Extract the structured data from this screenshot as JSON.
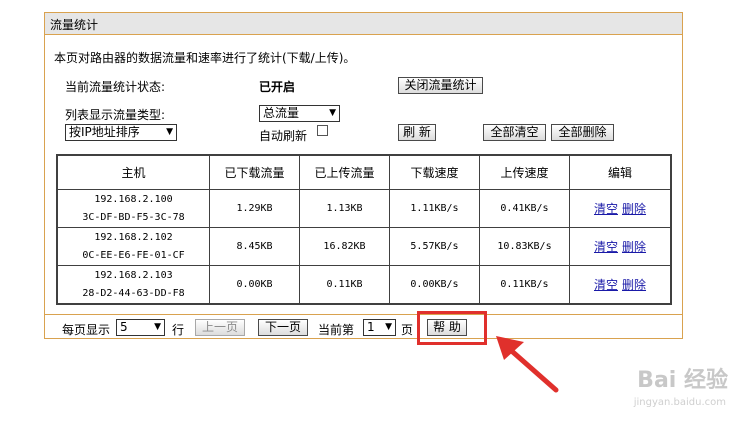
{
  "panel": {
    "title": "流量统计",
    "description": "本页对路由器的数据流量和速率进行了统计(下载/上传)。"
  },
  "status": {
    "label": "当前流量统计状态:",
    "value": "已开启",
    "toggle_button": "关闭流量统计"
  },
  "list_type": {
    "label": "列表显示流量类型:",
    "selected": "总流量",
    "sort_selected": "按IP地址排序",
    "auto_refresh_label": "自动刷新",
    "refresh_button": "刷 新",
    "clear_all_button": "全部清空",
    "delete_all_button": "全部删除"
  },
  "table": {
    "headers": [
      "主机",
      "已下载流量",
      "已上传流量",
      "下载速度",
      "上传速度",
      "编辑"
    ],
    "rows": [
      {
        "ip": "192.168.2.100",
        "mac": "3C-DF-BD-F5-3C-78",
        "downloaded": "1.29KB",
        "uploaded": "1.13KB",
        "down_speed": "1.11KB/s",
        "up_speed": "0.41KB/s",
        "clear": "清空",
        "delete": "删除"
      },
      {
        "ip": "192.168.2.102",
        "mac": "0C-EE-E6-FE-01-CF",
        "downloaded": "8.45KB",
        "uploaded": "16.82KB",
        "down_speed": "5.57KB/s",
        "up_speed": "10.83KB/s",
        "clear": "清空",
        "delete": "删除"
      },
      {
        "ip": "192.168.2.103",
        "mac": "28-D2-44-63-DD-F8",
        "downloaded": "0.00KB",
        "uploaded": "0.11KB",
        "down_speed": "0.00KB/s",
        "up_speed": "0.11KB/s",
        "clear": "清空",
        "delete": "删除"
      }
    ]
  },
  "pager": {
    "per_page_label": "每页显示",
    "per_page_value": "5",
    "rows_unit": "行",
    "prev_button": "上一页",
    "next_button": "下一页",
    "current_label": "当前第",
    "current_page": "1",
    "page_unit": "页",
    "help_button": "帮 助"
  },
  "watermark": {
    "brand": "Bai 经验",
    "url": "jingyan.baidu.com"
  },
  "colors": {
    "panel_border": "#d9a24f",
    "title_bg": "#e6e6e6",
    "link": "#1a1aa8",
    "highlight": "#e0302c"
  }
}
